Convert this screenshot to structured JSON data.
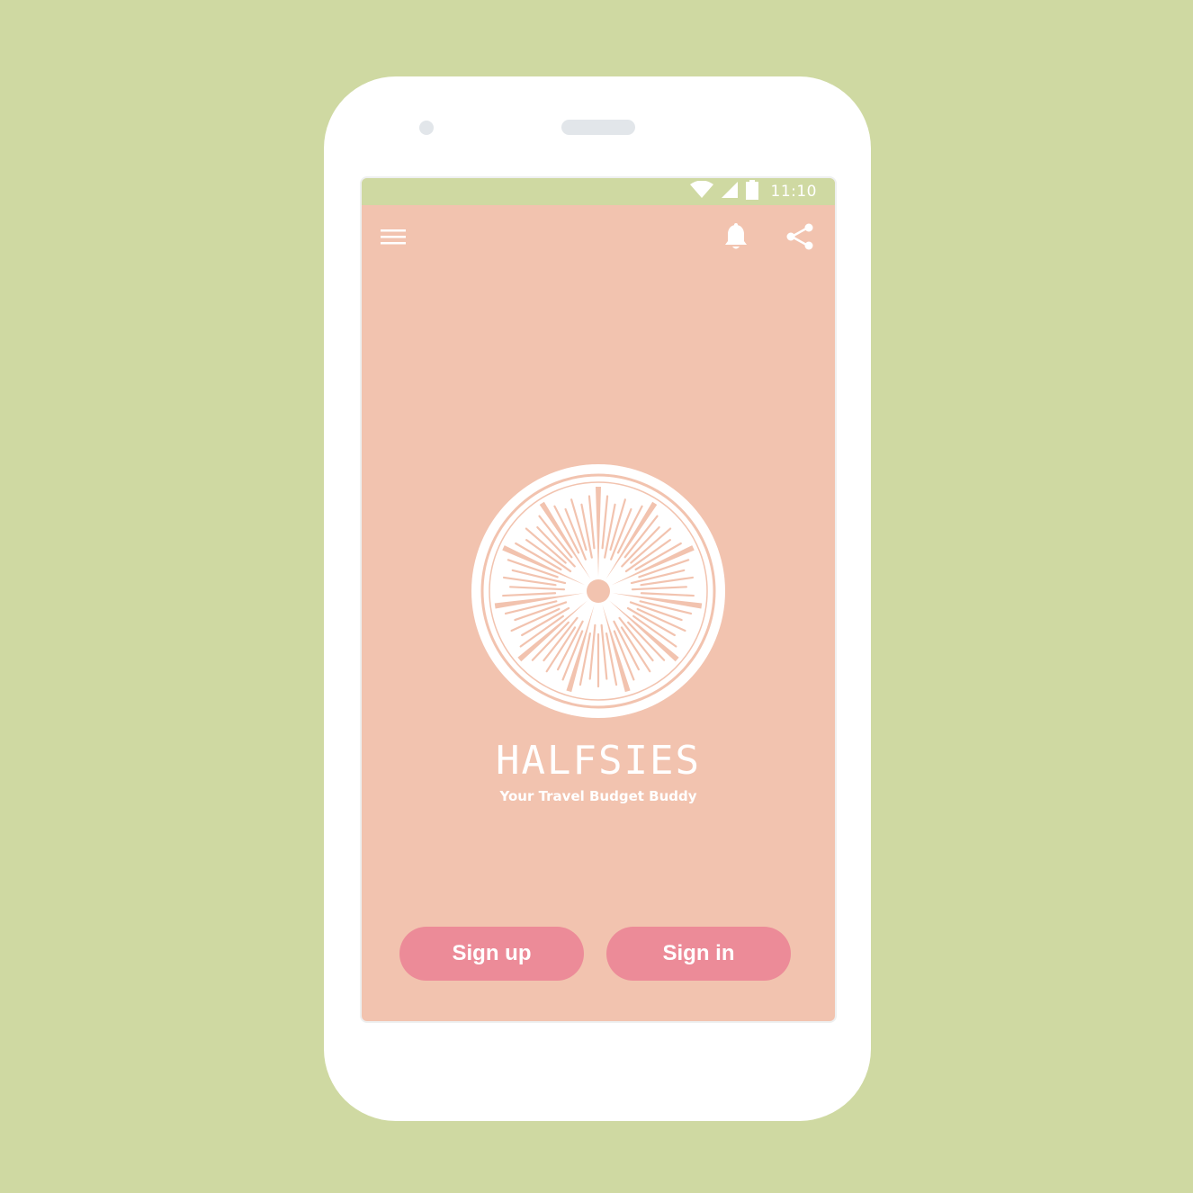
{
  "status_bar": {
    "time": "11:10",
    "icons": [
      "wifi-icon",
      "cellular-signal-icon",
      "battery-icon"
    ],
    "background": "#cfd9a2"
  },
  "app_bar": {
    "menu_icon": "hamburger-menu-icon",
    "actions": [
      "bell-icon",
      "share-icon"
    ]
  },
  "brand": {
    "logo": "grapefruit-slice-logo",
    "title": "HALFSIES",
    "tagline": "Your Travel Budget Buddy"
  },
  "actions": {
    "sign_up_label": "Sign up",
    "sign_in_label": "Sign in"
  },
  "colors": {
    "page_background": "#cfd9a2",
    "screen_background": "#f2c3af",
    "button": "#ec8b98",
    "text": "#ffffff"
  }
}
